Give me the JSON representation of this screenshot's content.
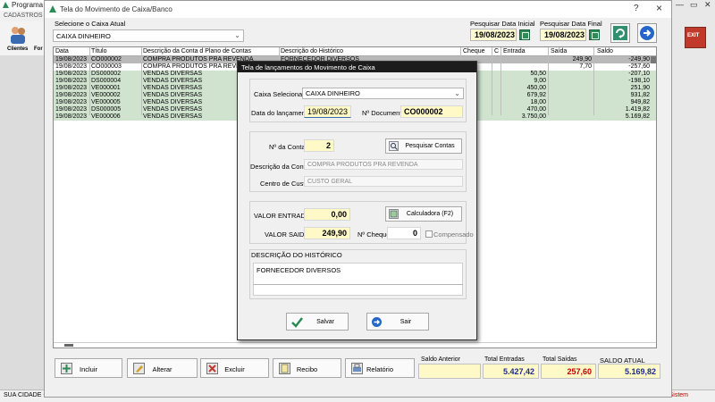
{
  "app": {
    "title_partial": "Programa g",
    "menu": "CADASTROS",
    "toolbar_label": "Clientes",
    "toolbar_label2": "For",
    "status_left": "SUA CIDADE -",
    "status_right": "Sistem"
  },
  "window": {
    "title": "Tela do Movimento de Caixa/Banco",
    "help": "?",
    "close": "×"
  },
  "filters": {
    "caixa_label": "Selecione o Caixa Atual",
    "caixa_value": "CAIXA DINHEIRO",
    "data_inicial_label": "Pesquisar Data Inicial",
    "data_inicial": "19/08/2023",
    "data_final_label": "Pesquisar Data Final",
    "data_final": "19/08/2023"
  },
  "grid": {
    "columns": [
      "Data",
      "Título",
      "Descrição da Conta d Plano de Contas",
      "Descrição do Histórico",
      "Cheque",
      "C",
      "Entrada",
      "Saída",
      "Saldo"
    ],
    "rows": [
      {
        "data": "19/08/2023",
        "titulo": "CO000002",
        "conta": "COMPRA PRODUTOS PRA REVENDA",
        "historico": "FORNECEDOR DIVERSOS",
        "entrada": "",
        "saida": "249,90",
        "saldo": "-249,90",
        "style": "sel"
      },
      {
        "data": "19/08/2023",
        "titulo": "CO000003",
        "conta": "COMPRA PRODUTOS PRA REVENDA",
        "historico": "",
        "entrada": "",
        "saida": "7,70",
        "saldo": "-257,60",
        "style": "w"
      },
      {
        "data": "19/08/2023",
        "titulo": "DS000002",
        "conta": "VENDAS DIVERSAS",
        "historico": "",
        "entrada": "50,50",
        "saida": "",
        "saldo": "-207,10",
        "style": "g"
      },
      {
        "data": "19/08/2023",
        "titulo": "DS000004",
        "conta": "VENDAS DIVERSAS",
        "historico": "",
        "entrada": "9,00",
        "saida": "",
        "saldo": "-198,10",
        "style": "g"
      },
      {
        "data": "19/08/2023",
        "titulo": "VE000001",
        "conta": "VENDAS DIVERSAS",
        "historico": "",
        "entrada": "450,00",
        "saida": "",
        "saldo": "251,90",
        "style": "g"
      },
      {
        "data": "19/08/2023",
        "titulo": "VE000002",
        "conta": "VENDAS DIVERSAS",
        "historico": "",
        "entrada": "679,92",
        "saida": "",
        "saldo": "931,82",
        "style": "g"
      },
      {
        "data": "19/08/2023",
        "titulo": "VE000005",
        "conta": "VENDAS DIVERSAS",
        "historico": "",
        "entrada": "18,00",
        "saida": "",
        "saldo": "949,82",
        "style": "g"
      },
      {
        "data": "19/08/2023",
        "titulo": "DS000005",
        "conta": "VENDAS DIVERSAS",
        "historico": "",
        "entrada": "470,00",
        "saida": "",
        "saldo": "1.419,82",
        "style": "g"
      },
      {
        "data": "19/08/2023",
        "titulo": "VE000006",
        "conta": "VENDAS DIVERSAS",
        "historico": "",
        "entrada": "3.750,00",
        "saida": "",
        "saldo": "5.169,82",
        "style": "g"
      }
    ]
  },
  "buttons": {
    "incluir": "Incluir",
    "alterar": "Alterar",
    "excluir": "Excluir",
    "recibo": "Recibo",
    "relatorio": "Relatório"
  },
  "summary": {
    "saldo_anterior_label": "Saldo Anterior",
    "saldo_anterior": "",
    "total_entradas_label": "Total Entradas",
    "total_entradas": "5.427,42",
    "total_saidas_label": "Total Saídas",
    "total_saidas": "257,60",
    "saldo_atual_label": "SALDO ATUAL",
    "saldo_atual": "5.169,82"
  },
  "dialog": {
    "title": "Tela de lançamentos do Movimento de Caixa",
    "caixa_label": "Caixa Selecionado",
    "caixa_value": "CAIXA DINHEIRO",
    "data_label": "Data do lançamento",
    "data_value": "19/08/2023",
    "documento_label": "Nº Documento",
    "documento_value": "CO000002",
    "conta_label": "Nº da Conta",
    "conta_value": "2",
    "pesquisar_contas": "Pesquisar Contas",
    "descricao_conta_label": "Descrição da Conta",
    "descricao_conta_value": "COMPRA PRODUTOS PRA REVENDA",
    "centro_custo_label": "Centro de Custo",
    "centro_custo_value": "CUSTO GERAL",
    "valor_entrada_label": "VALOR ENTRADA",
    "valor_entrada": "0,00",
    "calculadora": "Calculadora  (F2)",
    "valor_saida_label": "VALOR SAIDA",
    "valor_saida": "249,90",
    "cheque_label": "Nº Cheque",
    "cheque_value": "0",
    "compensado_label": "Compensado",
    "historico_label": "DESCRIÇÃO DO HISTÓRICO",
    "historico_value": "FORNECEDOR DIVERSOS",
    "salvar": "Salvar",
    "sair": "Sair"
  }
}
